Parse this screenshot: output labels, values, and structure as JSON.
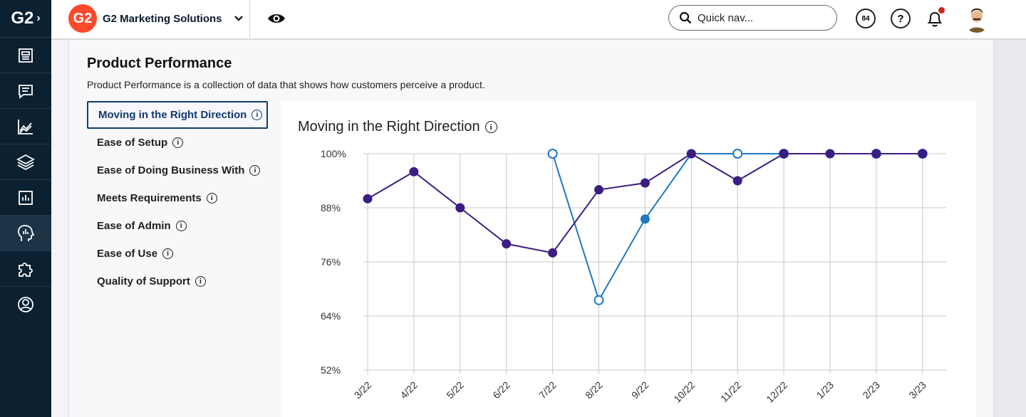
{
  "app": {
    "logo_text": "G2",
    "org_logo_text": "G2",
    "org_name": "G2 Marketing Solutions",
    "search_placeholder": "Quick nav...",
    "score_badge": "84",
    "help_glyph": "?"
  },
  "rail": {
    "items": [
      {
        "icon": "dashboard-icon"
      },
      {
        "icon": "reviews-icon"
      },
      {
        "icon": "trends-icon"
      },
      {
        "icon": "layers-icon"
      },
      {
        "icon": "reports-icon"
      },
      {
        "icon": "head-insights-icon"
      },
      {
        "icon": "integrations-icon"
      },
      {
        "icon": "profile-icon"
      }
    ],
    "active_index": 5
  },
  "page": {
    "title": "Product Performance",
    "description": "Product Performance is a collection of data that shows how customers perceive a product."
  },
  "metrics": [
    {
      "label": "Moving in the Right Direction",
      "active": true
    },
    {
      "label": "Ease of Setup",
      "active": false
    },
    {
      "label": "Ease of Doing Business With",
      "active": false
    },
    {
      "label": "Meets Requirements",
      "active": false
    },
    {
      "label": "Ease of Admin",
      "active": false
    },
    {
      "label": "Ease of Use",
      "active": false
    },
    {
      "label": "Quality of Support",
      "active": false
    }
  ],
  "colors": {
    "series_a": "#3b1d82",
    "series_b": "#1f78c1",
    "grid": "#c8c8c8",
    "active_border": "#0f3a6e"
  },
  "chart_data": {
    "type": "line",
    "title": "Moving in the Right Direction",
    "x": [
      "3/22",
      "4/22",
      "5/22",
      "6/22",
      "7/22",
      "8/22",
      "9/22",
      "10/22",
      "11/22",
      "12/22",
      "1/23",
      "2/23",
      "3/23"
    ],
    "ylim": [
      52,
      100
    ],
    "yticks": [
      "100%",
      "88%",
      "76%",
      "64%",
      "52%"
    ],
    "ytick_values": [
      100,
      88,
      76,
      64,
      52
    ],
    "grid": true,
    "series": [
      {
        "values": [
          90,
          96,
          88,
          80,
          78,
          92,
          93.5,
          100,
          94,
          100,
          100,
          100,
          100
        ],
        "marker": "filled"
      },
      {
        "values": [
          null,
          null,
          null,
          null,
          100,
          67.5,
          85.5,
          100,
          100,
          100,
          100,
          100,
          100
        ],
        "marker": "open"
      }
    ],
    "marker_styles": {
      "series_a": [
        "filled",
        "filled",
        "filled",
        "filled",
        "filled",
        "filled",
        "filled",
        "filled",
        "filled",
        "filled",
        "filled",
        "filled",
        "filled"
      ],
      "series_b": [
        null,
        null,
        null,
        null,
        "open",
        "open",
        "filled",
        "filled",
        "open",
        "open",
        "filled",
        "open",
        "open"
      ]
    }
  }
}
